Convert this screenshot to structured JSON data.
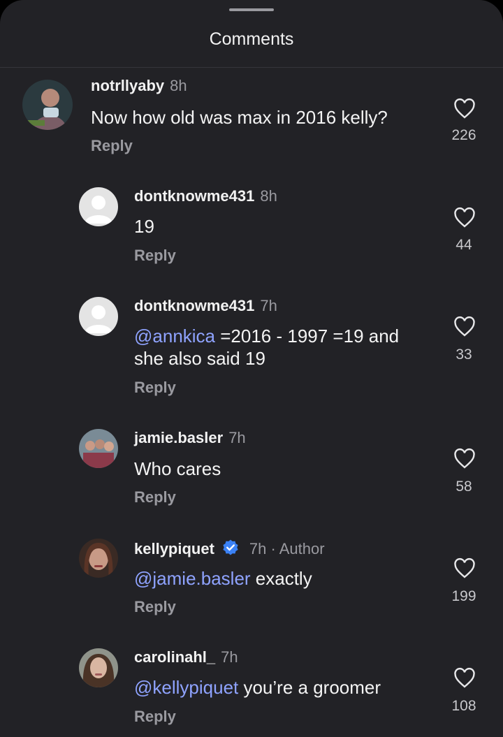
{
  "header": {
    "title": "Comments"
  },
  "comments": [
    {
      "username": "notrllyaby",
      "time": "8h",
      "text": "Now how old was max in 2016 kelly?",
      "reply_label": "Reply",
      "likes": "226",
      "avatar": "photo-avatar"
    },
    {
      "username": "dontknowme431",
      "time": "8h",
      "text": "19",
      "reply_label": "Reply",
      "likes": "44",
      "avatar": "default-avatar"
    },
    {
      "username": "dontknowme431",
      "time": "7h",
      "mention": "@annkica",
      "text": " =2016 - 1997 =19 and she also said 19",
      "reply_label": "Reply",
      "likes": "33",
      "avatar": "default-avatar"
    },
    {
      "username": "jamie.basler",
      "time": "7h",
      "text": "Who cares",
      "reply_label": "Reply",
      "likes": "58",
      "avatar": "photo-avatar"
    },
    {
      "username": "kellypiquet",
      "time": "7h",
      "author_badge": "Author",
      "verified": true,
      "mention": "@jamie.basler",
      "text": " exactly",
      "reply_label": "Reply",
      "likes": "199",
      "avatar": "photo-avatar"
    },
    {
      "username": "carolinahl_",
      "time": "7h",
      "mention": "@kellypiquet",
      "text": " you’re a groomer",
      "reply_label": "Reply",
      "likes": "108",
      "avatar": "photo-avatar"
    }
  ],
  "colors": {
    "background": "#222226",
    "mention": "#8fa3ff",
    "muted": "#9a9aa0",
    "verified": "#3b82f6"
  }
}
